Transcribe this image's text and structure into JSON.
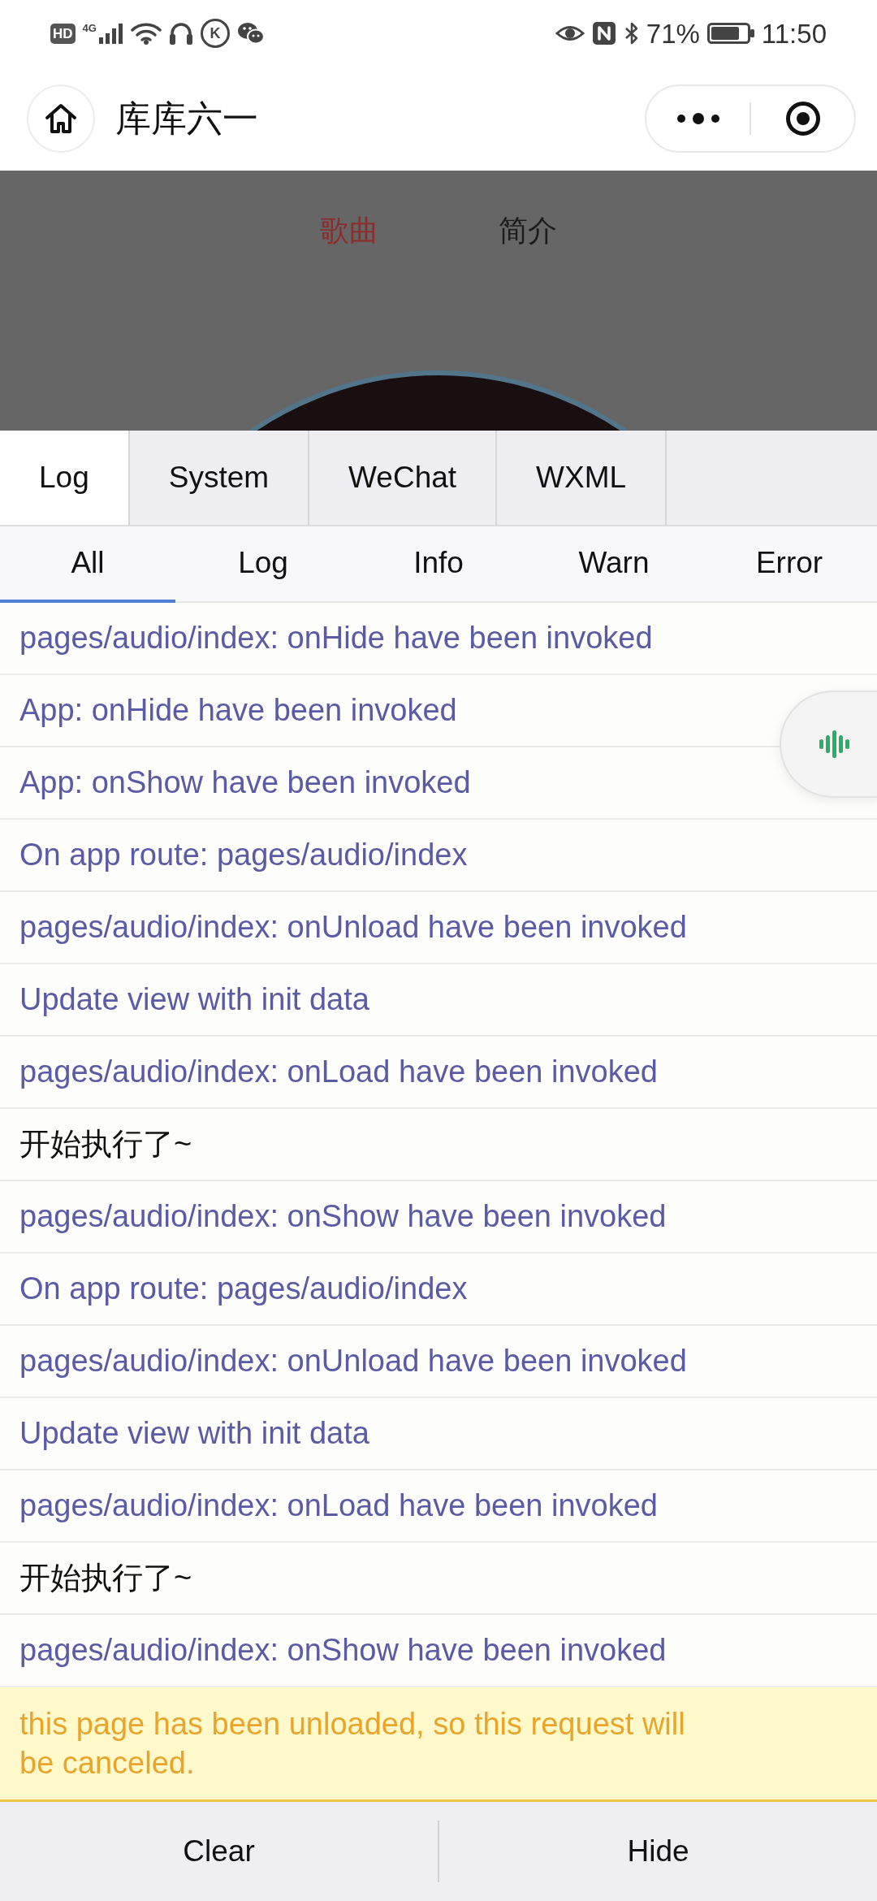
{
  "status_bar": {
    "hd_badge": "HD",
    "network_type": "4G",
    "k_badge": "K",
    "battery_percent": "71%",
    "time": "11:50"
  },
  "nav_bar": {
    "title": "库库六一"
  },
  "page": {
    "tabs": [
      {
        "label": "歌曲",
        "selected": true
      },
      {
        "label": "简介",
        "selected": false
      }
    ]
  },
  "console": {
    "tabs": [
      {
        "label": "Log",
        "selected": true
      },
      {
        "label": "System",
        "selected": false
      },
      {
        "label": "WeChat",
        "selected": false
      },
      {
        "label": "WXML",
        "selected": false
      }
    ],
    "filters": [
      {
        "label": "All",
        "selected": true
      },
      {
        "label": "Log",
        "selected": false
      },
      {
        "label": "Info",
        "selected": false
      },
      {
        "label": "Warn",
        "selected": false
      },
      {
        "label": "Error",
        "selected": false
      }
    ],
    "logs": [
      {
        "kind": "system",
        "text": "pages/audio/index: onHide have been invoked"
      },
      {
        "kind": "system",
        "text": "App: onHide have been invoked"
      },
      {
        "kind": "system",
        "text": "App: onShow have been invoked"
      },
      {
        "kind": "system",
        "text": "On app route: pages/audio/index"
      },
      {
        "kind": "system",
        "text": "pages/audio/index: onUnload have been invoked"
      },
      {
        "kind": "system",
        "text": "Update view with init data"
      },
      {
        "kind": "system",
        "text": "pages/audio/index: onLoad have been invoked"
      },
      {
        "kind": "log",
        "text": "开始执行了~"
      },
      {
        "kind": "system",
        "text": "pages/audio/index: onShow have been invoked"
      },
      {
        "kind": "system",
        "text": "On app route: pages/audio/index"
      },
      {
        "kind": "system",
        "text": "pages/audio/index: onUnload have been invoked"
      },
      {
        "kind": "system",
        "text": "Update view with init data"
      },
      {
        "kind": "system",
        "text": "pages/audio/index: onLoad have been invoked"
      },
      {
        "kind": "log",
        "text": "开始执行了~"
      },
      {
        "kind": "system",
        "text": "pages/audio/index: onShow have been invoked"
      },
      {
        "kind": "warn",
        "text": "this page has been unloaded, so this request will be canceled."
      }
    ],
    "buttons": [
      "Clear",
      "Hide"
    ]
  }
}
